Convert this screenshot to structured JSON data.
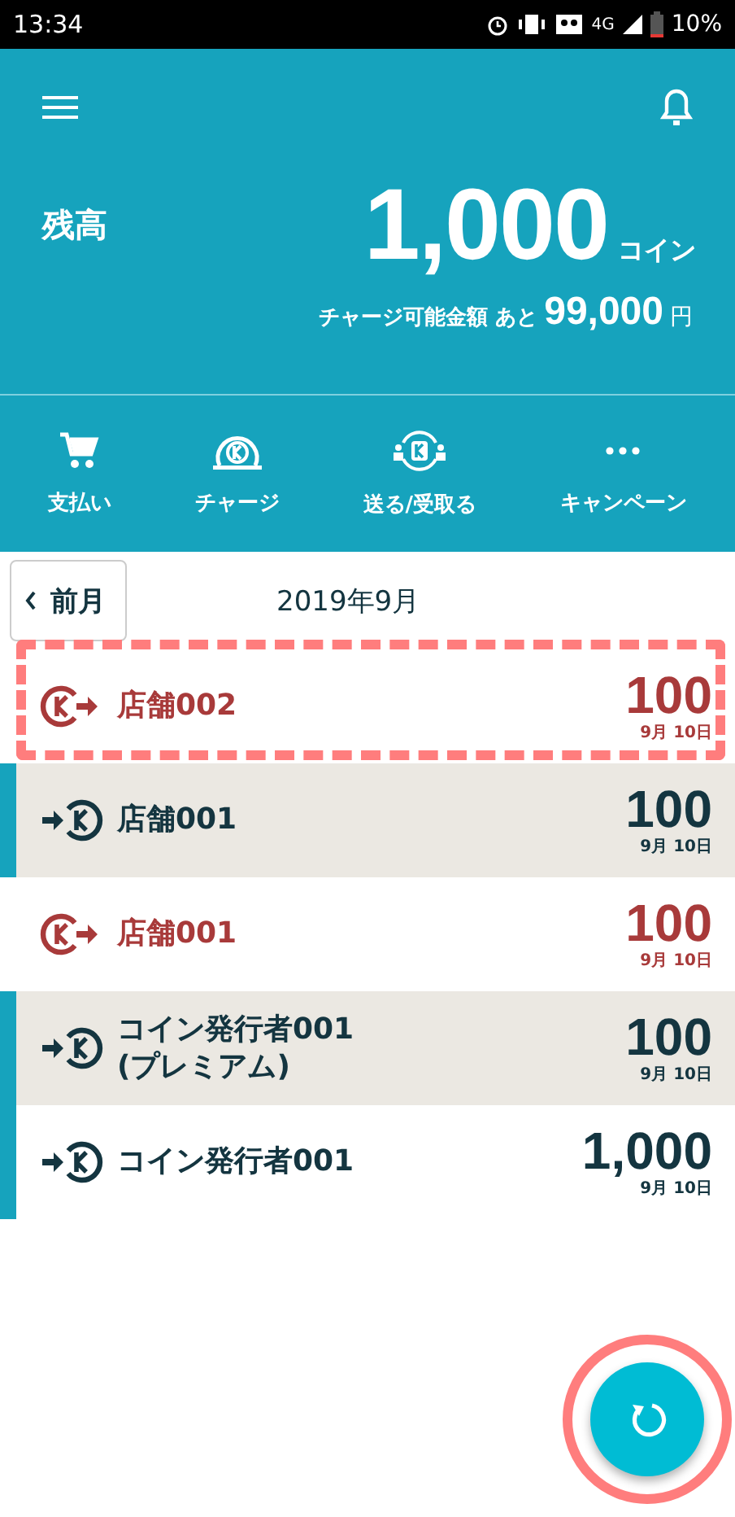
{
  "status_bar": {
    "time": "13:34",
    "network": "4G",
    "battery": "10%"
  },
  "balance": {
    "label": "残高",
    "amount": "1,000",
    "unit": "コイン",
    "charge_label": "チャージ可能金額 あと",
    "charge_amount": "99,000",
    "charge_unit": "円"
  },
  "actions": [
    {
      "kind": "cart",
      "label": "支払い"
    },
    {
      "kind": "charge",
      "label": "チャージ"
    },
    {
      "kind": "transfer",
      "label": "送る/受取る"
    },
    {
      "kind": "more",
      "label": "キャンペーン"
    }
  ],
  "month_nav": {
    "prev": "前月",
    "current": "2019年9月"
  },
  "transactions": [
    {
      "kind": "out",
      "name": "店舗002",
      "amount": "100",
      "date": "9月 10日",
      "shaded": false,
      "marked": false,
      "highlighted": true
    },
    {
      "kind": "in",
      "name": "店舗001",
      "amount": "100",
      "date": "9月 10日",
      "shaded": true,
      "marked": true,
      "highlighted": false
    },
    {
      "kind": "out",
      "name": "店舗001",
      "amount": "100",
      "date": "9月 10日",
      "shaded": false,
      "marked": false,
      "highlighted": false
    },
    {
      "kind": "in",
      "name": "コイン発行者001\n(プレミアム)",
      "amount": "100",
      "date": "9月 10日",
      "shaded": true,
      "marked": true,
      "highlighted": false
    },
    {
      "kind": "in",
      "name": "コイン発行者001",
      "amount": "1,000",
      "date": "9月 10日",
      "shaded": false,
      "marked": true,
      "highlighted": false
    }
  ],
  "refresh_button": {
    "highlighted": true
  }
}
